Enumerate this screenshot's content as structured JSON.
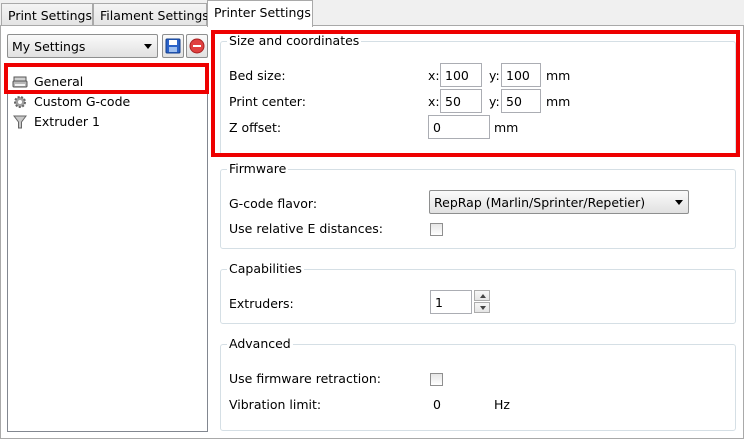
{
  "tabs": [
    {
      "label": "Print Settings"
    },
    {
      "label": "Filament Settings"
    },
    {
      "label": "Printer Settings"
    }
  ],
  "preset": {
    "selected": "My Settings"
  },
  "tree": {
    "items": [
      {
        "label": "General"
      },
      {
        "label": "Custom G-code"
      },
      {
        "label": "Extruder 1"
      }
    ]
  },
  "size_coords": {
    "title": "Size and coordinates",
    "bed_size_label": "Bed size:",
    "bed_x_prefix": "x:",
    "bed_x": "100",
    "bed_y_prefix": "y:",
    "bed_y": "100",
    "bed_unit": "mm",
    "center_label": "Print center:",
    "center_x_prefix": "x:",
    "center_x": "50",
    "center_y_prefix": "y:",
    "center_y": "50",
    "center_unit": "mm",
    "z_offset_label": "Z offset:",
    "z_offset": "0",
    "z_unit": "mm"
  },
  "firmware": {
    "title": "Firmware",
    "flavor_label": "G-code flavor:",
    "flavor_value": "RepRap (Marlin/Sprinter/Repetier)",
    "relative_e_label": "Use relative E distances:",
    "relative_e_checked": false
  },
  "capabilities": {
    "title": "Capabilities",
    "extruders_label": "Extruders:",
    "extruders_value": "1"
  },
  "advanced": {
    "title": "Advanced",
    "fw_retraction_label": "Use firmware retraction:",
    "fw_retraction_checked": false,
    "vibration_label": "Vibration limit:",
    "vibration_value": "0",
    "vibration_unit": "Hz"
  },
  "colors": {
    "highlight": "#ee0000",
    "save_icon": "#2a62c9",
    "delete_icon": "#e04040"
  }
}
